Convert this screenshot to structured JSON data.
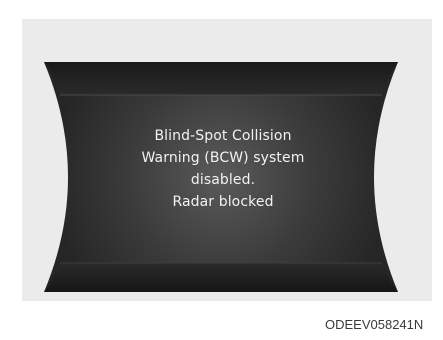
{
  "display": {
    "message_lines": [
      "Blind-Spot Collision",
      "Warning (BCW) system",
      "disabled.",
      "Radar blocked"
    ]
  },
  "figure_code": "ODEEV058241N",
  "colors": {
    "panel_background": "#ebebeb",
    "display_dark": "#1c1c1c",
    "display_center": "#5a5a5a",
    "text": "#f2f2f2"
  }
}
